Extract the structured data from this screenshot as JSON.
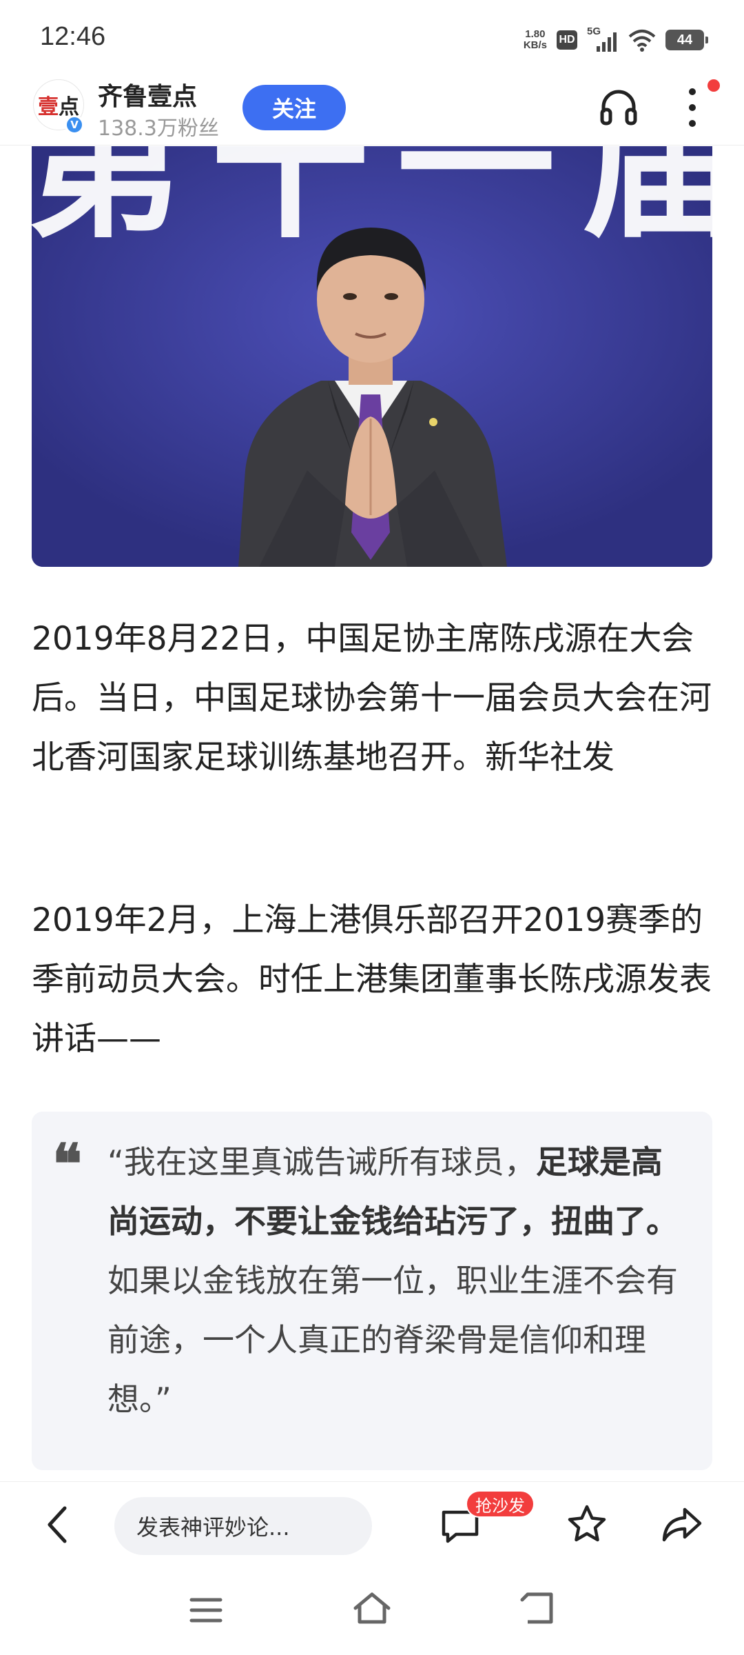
{
  "status_bar": {
    "time": "12:46",
    "net_speed_value": "1.80",
    "net_speed_unit": "KB/s",
    "hd_label": "HD",
    "network_label": "5G",
    "battery_level": "44"
  },
  "header": {
    "avatar_text_red": "壹",
    "avatar_text_dark": "点",
    "author_name": "齐鲁壹点",
    "fans_count": "138.3万粉丝",
    "follow_label": "关注"
  },
  "photo": {
    "backdrop_text": "第十一届"
  },
  "article": {
    "paragraph_1": "2019年8月22日，中国足协主席陈戌源在大会后。当日，中国足球协会第十一届会员大会在河北香河国家足球训练基地召开。新华社发",
    "paragraph_2": "2019年2月，上海上港俱乐部召开2019赛季的季前动员大会。时任上港集团董事长陈戌源发表讲话——",
    "quote_mark": "❝",
    "quote_open": "“我在这里真诚告诫所有球员，",
    "quote_bold": "足球是高尚运动，不要让金钱给玷污了，扭曲了。",
    "quote_rest": "如果以金钱放在第一位，职业生涯不会有前途，一个人真正的脊梁骨是信仰和理想。”"
  },
  "toolbar": {
    "comment_placeholder": "发表神评妙论...",
    "sofa_badge": "抢沙发"
  },
  "colors": {
    "accent": "#3d6ff2",
    "badge_red": "#f23d3d",
    "quote_bg": "#f4f5f9"
  }
}
